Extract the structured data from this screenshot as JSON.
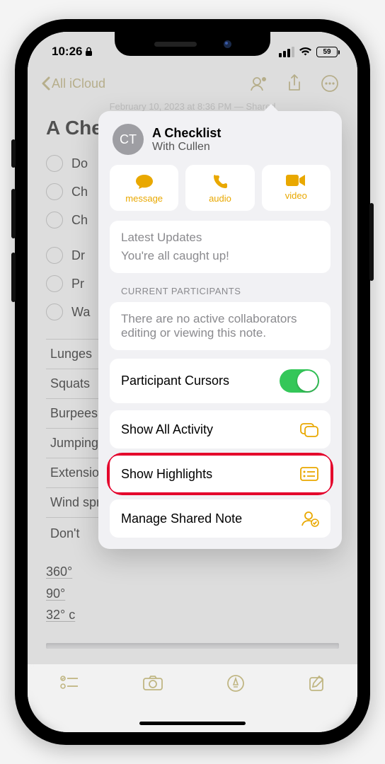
{
  "status": {
    "time": "10:26",
    "battery": "59"
  },
  "nav": {
    "back_label": "All iCloud"
  },
  "ghost_ts": "February 10, 2023 at 8:36 PM — Shared",
  "note": {
    "title": "A Checklist",
    "items": [
      "Do",
      "Ch",
      "Ch",
      "Dr",
      "Pr",
      "Wa"
    ],
    "table_rows": [
      "Lunges",
      "Squats",
      "Burpees",
      "Jumping",
      "Extensions",
      "Wind sprints"
    ],
    "dont": "Don't",
    "degrees": [
      "360°",
      "90°",
      "32° c"
    ]
  },
  "popover": {
    "avatar_initials": "CT",
    "title": "A Checklist",
    "subtitle": "With Cullen",
    "actions": {
      "message": "message",
      "audio": "audio",
      "video": "video"
    },
    "updates_hdr": "Latest Updates",
    "updates_body": "You're all caught up!",
    "participants_label": "CURRENT PARTICIPANTS",
    "participants_body": "There are no active collaborators editing or viewing this note.",
    "rows": {
      "cursors": "Participant Cursors",
      "activity": "Show All Activity",
      "highlights": "Show Highlights",
      "manage": "Manage Shared Note"
    }
  }
}
